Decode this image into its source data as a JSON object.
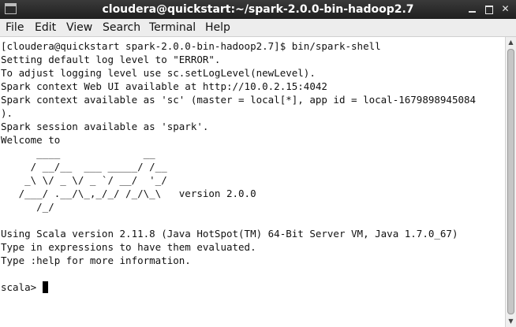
{
  "window": {
    "title": "cloudera@quickstart:~/spark-2.0.0-bin-hadoop2.7",
    "icon": "terminal-icon",
    "controls": {
      "minimize_icon": "minimize-icon",
      "maximize_icon": "maximize-icon",
      "close_glyph": "✕"
    }
  },
  "menu": {
    "items": [
      "File",
      "Edit",
      "View",
      "Search",
      "Terminal",
      "Help"
    ]
  },
  "terminal": {
    "lines": [
      "[cloudera@quickstart spark-2.0.0-bin-hadoop2.7]$ bin/spark-shell",
      "Setting default log level to \"ERROR\".",
      "To adjust logging level use sc.setLogLevel(newLevel).",
      "Spark context Web UI available at http://10.0.2.15:4042",
      "Spark context available as 'sc' (master = local[*], app id = local-1679898945084",
      ").",
      "Spark session available as 'spark'.",
      "Welcome to",
      "      ____              __",
      "     / __/__  ___ _____/ /__",
      "    _\\ \\/ _ \\/ _ `/ __/  '_/",
      "   /___/ .__/\\_,_/_/ /_/\\_\\   version 2.0.0",
      "      /_/",
      "",
      "Using Scala version 2.11.8 (Java HotSpot(TM) 64-Bit Server VM, Java 1.7.0_67)",
      "Type in expressions to have them evaluated.",
      "Type :help for more information.",
      ""
    ],
    "prompt": "scala> "
  },
  "scrollbar": {
    "up_glyph": "▲",
    "down_glyph": "▼"
  },
  "colors": {
    "titlebar": "#2b2b2b",
    "menubar": "#ededed",
    "terminal_bg": "#ffffff",
    "terminal_fg": "#111111"
  }
}
